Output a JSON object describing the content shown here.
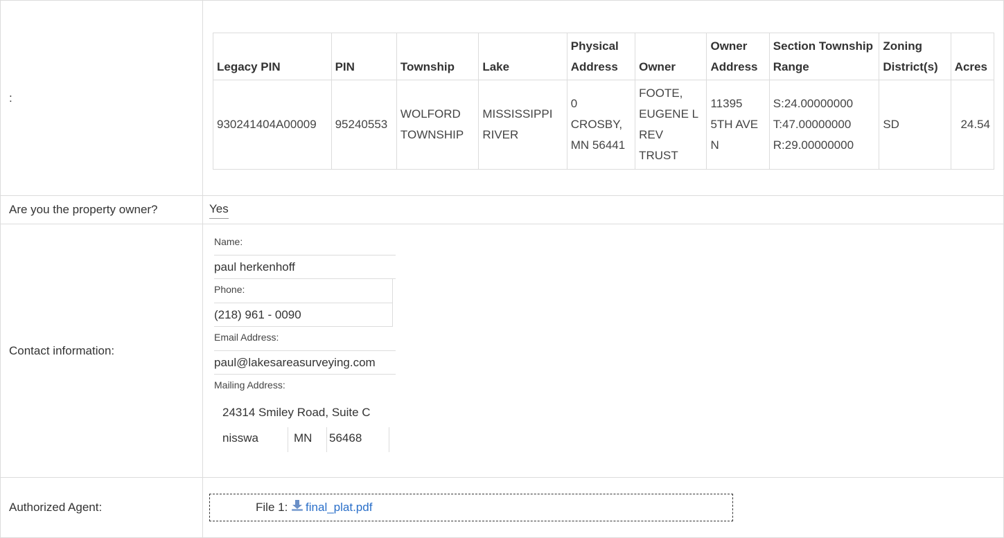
{
  "parcel": {
    "row_label": ":",
    "headers": [
      "Legacy PIN",
      "PIN",
      "Township",
      "Lake",
      "Physical Address",
      "Owner",
      "Owner Address",
      "Section Township Range",
      "Zoning District(s)",
      "Acres"
    ],
    "row": {
      "legacy_pin": "930241404A00009",
      "pin": "95240553",
      "township": "WOLFORD TOWNSHIP",
      "lake": "MISSISSIPPI RIVER",
      "physical_address": "0 CROSBY, MN 56441",
      "owner": "FOOTE, EUGENE L REV TRUST",
      "owner_address": "11395 5TH AVE N",
      "str_s": "S:24.00000000",
      "str_t": "T:47.00000000",
      "str_r": "R:29.00000000",
      "zoning": "SD",
      "acres": "24.54"
    }
  },
  "owner_question": {
    "label": "Are you the property owner?",
    "value": "Yes"
  },
  "contact": {
    "label": "Contact information:",
    "name_label": "Name:",
    "name": "paul herkenhoff",
    "phone_label": "Phone:",
    "phone": "(218) 961 - 0090",
    "email_label": "Email Address:",
    "email": "paul@lakesareasurveying.com",
    "mailing_label": "Mailing Address:",
    "street": "24314 Smiley Road, Suite C",
    "city": "nisswa",
    "state": "MN",
    "zip": "56468"
  },
  "agent": {
    "label": "Authorized Agent:",
    "file_prefix": "File 1:",
    "file_name": "final_plat.pdf",
    "file_icon": "download-icon",
    "link_color": "#2a6fc9"
  }
}
